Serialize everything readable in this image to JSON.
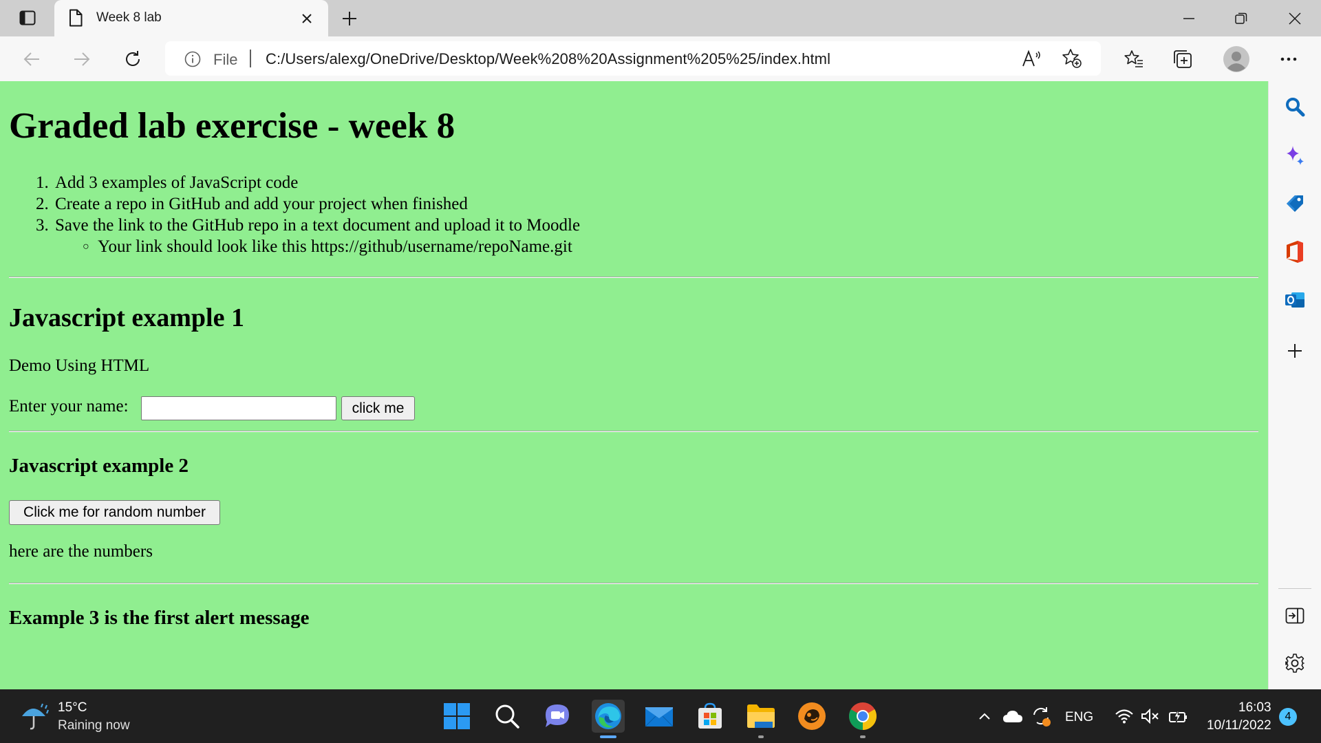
{
  "browser": {
    "tab": {
      "title": "Week 8 lab"
    },
    "address_bar": {
      "scheme_label": "File",
      "url": "C:/Users/alexg/OneDrive/Desktop/Week%208%20Assignment%205%25/index.html"
    }
  },
  "page": {
    "title": "Graded lab exercise - week 8",
    "steps": [
      {
        "num": "1.",
        "text": "Add 3 examples of JavaScript code"
      },
      {
        "num": "2.",
        "text": "Create a repo in GitHub and add your project when finished"
      },
      {
        "num": "3.",
        "text": "Save the link to the GitHub repo in a text document and upload it to Moodle"
      }
    ],
    "sub_step": "Your link should look like this https://github/username/repoName.git",
    "example1": {
      "heading": "Javascript example 1",
      "subtitle": "Demo Using HTML",
      "name_label": "Enter your name:",
      "name_value": "",
      "button_label": "click me"
    },
    "example2": {
      "heading": "Javascript example 2",
      "button_label": "Click me for random number",
      "output_text": "here are the numbers"
    },
    "example3": {
      "heading": "Example 3 is the first alert message"
    }
  },
  "taskbar": {
    "weather": {
      "temp": "15°C",
      "description": "Raining now"
    },
    "tray": {
      "language": "ENG"
    },
    "clock": {
      "time": "16:03",
      "date": "10/11/2022"
    },
    "notification_count": "4"
  },
  "colors": {
    "page_background": "#90ee90",
    "browser_chrome": "#f7f7f7",
    "tabstrip": "#cfcfcf",
    "taskbar": "#202020",
    "accent": "#0078d4"
  }
}
